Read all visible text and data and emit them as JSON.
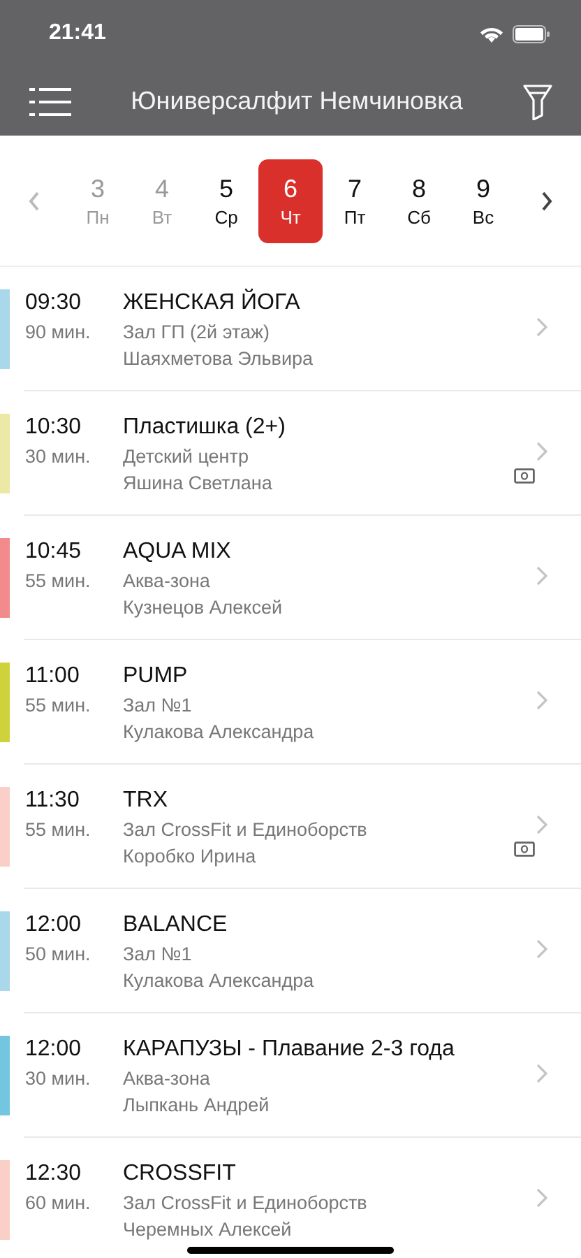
{
  "status_bar": {
    "time": "21:41"
  },
  "nav": {
    "title": "Юниверсалфит Немчиновка"
  },
  "days": [
    {
      "number": "3",
      "weekday": "Пн",
      "past": true,
      "selected": false
    },
    {
      "number": "4",
      "weekday": "Вт",
      "past": true,
      "selected": false
    },
    {
      "number": "5",
      "weekday": "Ср",
      "past": false,
      "selected": false
    },
    {
      "number": "6",
      "weekday": "Чт",
      "past": false,
      "selected": true
    },
    {
      "number": "7",
      "weekday": "Пт",
      "past": false,
      "selected": false
    },
    {
      "number": "8",
      "weekday": "Сб",
      "past": false,
      "selected": false
    },
    {
      "number": "9",
      "weekday": "Вс",
      "past": false,
      "selected": false
    }
  ],
  "classes": [
    {
      "time": "09:30",
      "duration": "90 мин.",
      "title": "ЖЕНСКАЯ ЙОГА",
      "room": "Зал ГП (2й этаж)",
      "trainer": "Шаяхметова Эльвира",
      "color": "#a8d8ea",
      "paid": false
    },
    {
      "time": "10:30",
      "duration": "30 мин.",
      "title": "Пластишка (2+)",
      "room": "Детский центр",
      "trainer": "Яшина Светлана",
      "color": "#ece9a6",
      "paid": true
    },
    {
      "time": "10:45",
      "duration": "55 мин.",
      "title": "AQUA MIX",
      "room": "Аква-зона",
      "trainer": "Кузнецов Алексей",
      "color": "#f28b8b",
      "paid": false
    },
    {
      "time": "11:00",
      "duration": "55 мин.",
      "title": "PUMP",
      "room": "Зал №1",
      "trainer": "Кулакова Александра",
      "color": "#cfd23a",
      "paid": false
    },
    {
      "time": "11:30",
      "duration": "55 мин.",
      "title": "TRX",
      "room": "Зал CrossFit и Единоборств",
      "trainer": "Коробко Ирина",
      "color": "#f9cfc7",
      "paid": true
    },
    {
      "time": "12:00",
      "duration": "50 мин.",
      "title": "BALANCE",
      "room": "Зал №1",
      "trainer": "Кулакова Александра",
      "color": "#a8d8ea",
      "paid": false
    },
    {
      "time": "12:00",
      "duration": "30 мин.",
      "title": "КАРАПУЗЫ - Плавание 2-3 года",
      "room": "Аква-зона",
      "trainer": "Лыпкань Андрей",
      "color": "#72c6e0",
      "paid": false
    },
    {
      "time": "12:30",
      "duration": "60 мин.",
      "title": "CROSSFIT",
      "room": "Зал CrossFit и Единоборств",
      "trainer": "Черемных Алексей",
      "color": "#f9cfc7",
      "paid": false
    }
  ]
}
